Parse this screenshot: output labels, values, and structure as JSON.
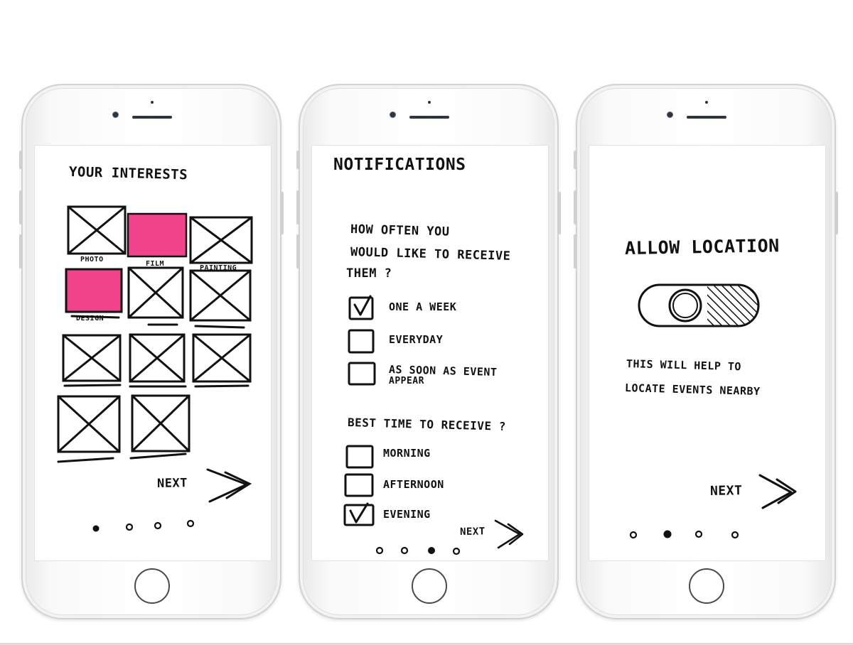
{
  "colors": {
    "accent_pink": "#f0438a",
    "ink": "#111111"
  },
  "screens": [
    {
      "title": "YOUR INTERESTS",
      "tile_labels": [
        "PHOTO",
        "FILM",
        "PAINTING",
        "DESIGN"
      ],
      "next_label": "NEXT",
      "next_icon": "double-chevron-right-icon",
      "selected_tiles": [
        "FILM",
        "DESIGN"
      ],
      "page_indicator": {
        "total": 4,
        "active": 1
      }
    },
    {
      "title": "NOTIFICATIONS",
      "question1": [
        "HOW OFTEN YOU",
        "WOULD LIKE TO RECEIVE",
        "THEM ?"
      ],
      "frequency_options": [
        {
          "label": "ONE A WEEK",
          "checked": true
        },
        {
          "label": "EVERYDAY",
          "checked": false
        },
        {
          "label": "AS SOON AS EVENT",
          "label2": "APPEAR",
          "checked": false
        }
      ],
      "question2": "BEST TIME TO RECEIVE ?",
      "time_options": [
        {
          "label": "MORNING",
          "checked": false
        },
        {
          "label": "AFTERNOON",
          "checked": false
        },
        {
          "label": "EVENING",
          "checked": true
        }
      ],
      "next_label": "NEXT",
      "next_icon": "double-chevron-right-icon",
      "page_indicator": {
        "total": 4,
        "active": 3
      }
    },
    {
      "title": "ALLOW LOCATION",
      "toggle_state": "on",
      "helper_line1": "THIS WILL HELP TO",
      "helper_line2": "LOCATE EVENTS NEARBY",
      "next_label": "NEXT",
      "next_icon": "double-chevron-right-icon",
      "page_indicator": {
        "total": 4,
        "active": 2
      }
    }
  ]
}
